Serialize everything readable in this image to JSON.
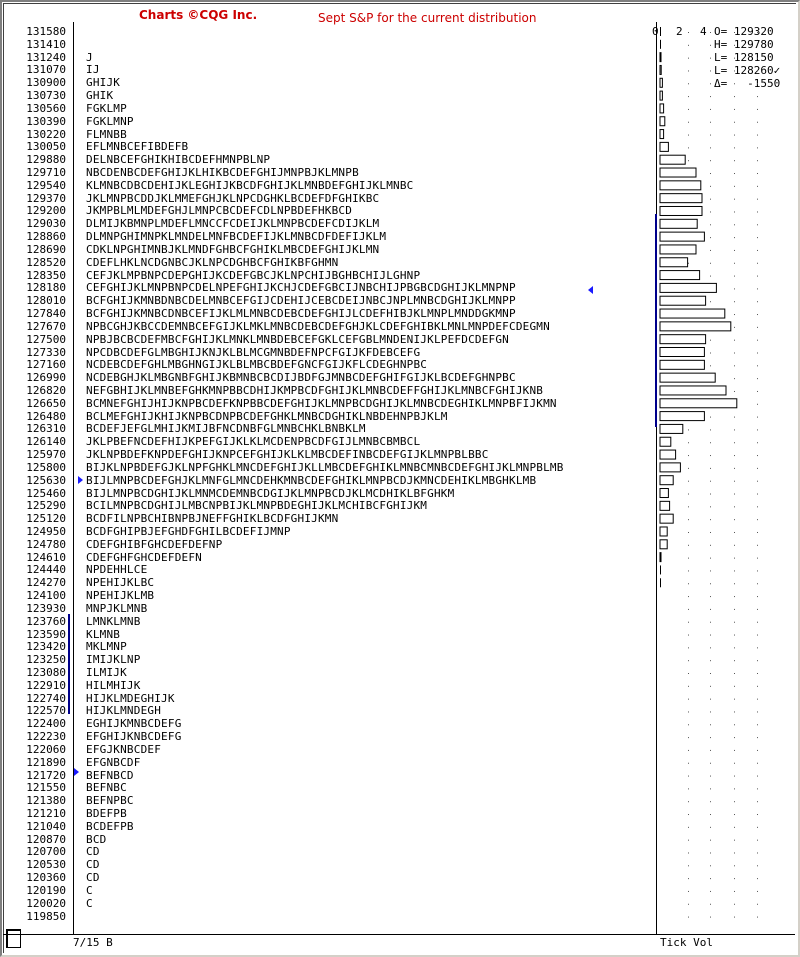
{
  "header": {
    "brand": "Charts ©CQG Inc.",
    "title": "Sept S&P for the current distribution"
  },
  "volume_scale": [
    "0",
    "2",
    "4"
  ],
  "stats": [
    "O= 129320",
    "H= 129780",
    "L= 128150",
    "L= 128260✓",
    "Δ=   -1550"
  ],
  "footer": {
    "date_label": "7/15 B",
    "panel_label": "Tick Vol"
  },
  "colors": {
    "title": "#cc0000",
    "value_area": "#00008b",
    "marker": "#1a1aff"
  },
  "chart_data": {
    "type": "table",
    "title": "Sept S&P for the current distribution",
    "rows": [
      {
        "price": "131580",
        "letters": "",
        "vol": 0
      },
      {
        "price": "131410",
        "letters": "",
        "vol": 0
      },
      {
        "price": "131240",
        "letters": "J",
        "vol": 0.05
      },
      {
        "price": "131070",
        "letters": "IJ",
        "vol": 0.1
      },
      {
        "price": "130900",
        "letters": "GHIJK",
        "vol": 0.2
      },
      {
        "price": "130730",
        "letters": "GHIK",
        "vol": 0.2
      },
      {
        "price": "130560",
        "letters": "FGKLMP",
        "vol": 0.3
      },
      {
        "price": "130390",
        "letters": "FGKLMNP",
        "vol": 0.4
      },
      {
        "price": "130220",
        "letters": "FLMNBB",
        "vol": 0.3
      },
      {
        "price": "130050",
        "letters": "EFLMNBCEFIBDEFB",
        "vol": 0.7
      },
      {
        "price": "129880",
        "letters": "DELNBCEFGHIKHIBCDEFHMNPBLNP",
        "vol": 2.1
      },
      {
        "price": "129710",
        "letters": "NBCDENBCDEFGHIJKLHIKBCDEFGHIJMNPBJKLMNPB",
        "vol": 3.0
      },
      {
        "price": "129540",
        "letters": "KLMNBCDBCDEHIJKLEGHIJKBCDFGHIJKLMNBDEFGHIJKLMNBC",
        "vol": 3.4
      },
      {
        "price": "129370",
        "letters": "JKLMNPBCDDJKLMMEFGHJKLNPCDGHKLBCDEFDFGHIKBC",
        "vol": 3.5
      },
      {
        "price": "129200",
        "letters": "JKMPBLMLMDEFGHJLMNPCBCDEFCDLNPBDEFHKBCD",
        "vol": 3.5
      },
      {
        "price": "129030",
        "letters": "DLMIJKBMNPLMDEFLMNCCFCDEIJKLMNPBCDEFCDIJKLM",
        "vol": 3.1
      },
      {
        "price": "128860",
        "letters": "DLMNPGHIMNPKLMNDELMNFBCDEFIJKLMNBCDFDEFIJKLM",
        "vol": 3.7
      },
      {
        "price": "128690",
        "letters": "CDKLNPGHIMNBJKLMNDFGHBCFGHIKLMBCDEFGHIJKLMN",
        "vol": 3.0
      },
      {
        "price": "128520",
        "letters": "CDEFLHKLNCDGNBCJKLNPCDGHBCFGHIKBFGHMN",
        "vol": 2.3
      },
      {
        "price": "128350",
        "letters": "CEFJKLMPBNPCDEPGHIJKCDEFGBCJKLNPCHIJBGHBCHIJLGHNP",
        "vol": 3.3
      },
      {
        "price": "128180",
        "letters": "CEFGHIJKLMNPBNPCDELNPEFGHIJKCHJCDEFGBCIJNBCHIJPBGBCDGHIJKLMNPNP",
        "vol": 4.7
      },
      {
        "price": "128010",
        "letters": "BCFGHIJKMNBDNBCDELMNBCEFGIJCDEHIJCEBCDEIJNBCJNPLMNBCDGHIJKLMNPP",
        "vol": 3.8
      },
      {
        "price": "127840",
        "letters": "BCFGHIJKMNBCDNBCEFIJKLMLMNBCDEBCDEFGHIJLCDEFHIBJKLMNPLMNDDGKMNP",
        "vol": 5.4
      },
      {
        "price": "127670",
        "letters": "NPBCGHJKBCCDEMNBCEFGIJKLMKLMNBCDEBCDEFGHJKLCDEFGHIBKLMNLMNPDEFCDEGMN",
        "vol": 5.9
      },
      {
        "price": "127500",
        "letters": "NPBJBCBCDEFMBCFGHIJKLMNKLMNBDEBCEFGKLCEFGBLMNDENIJKLPEFDCDEFGN",
        "vol": 3.8
      },
      {
        "price": "127330",
        "letters": "NPCDBCDEFGLMBGHIJKNJKLBLMCGMNBDEFNPCFGIJKFDEBCEFG",
        "vol": 3.7
      },
      {
        "price": "127160",
        "letters": "NCDEBCDEFGHLMBGHNGIJKLBLMBCBDEFGNCFGIJKFLCDEGHNPBC",
        "vol": 3.7
      },
      {
        "price": "126990",
        "letters": "NCDEBGHJKLMBGNBFGHIJKBMNBCBCDIJBDFGJMNBCDEFGHIFGIJKLBCDEFGHNPBC",
        "vol": 4.6
      },
      {
        "price": "126820",
        "letters": "NEFGBHIJKLMNBEFGHKMNPBBCDHIJKMPBCDFGHIJKLMNBCDEFFGHIJKLMNBCFGHIJKNB",
        "vol": 5.5
      },
      {
        "price": "126650",
        "letters": "BCMNEFGHIJHIJKNPBCDEFKNPBBCDEFGHIJKLMNPBCDGHIJKLMNBCDEGHIKLMNPBFIJKMN",
        "vol": 6.4
      },
      {
        "price": "126480",
        "letters": "BCLMEFGHIJKHIJKNPBCDNPBCDEFGHKLMNBCDGHIKLNBDEHNPBJKLM",
        "vol": 3.7
      },
      {
        "price": "126310",
        "letters": "BCDEFJEFGLMHIJKMIJBFNCDNBFGLMNBCHKLBNBKLM",
        "vol": 1.9
      },
      {
        "price": "126140",
        "letters": "JKLPBEFNCDEFHIJKPEFGIJKLKLMCDENPBCDFGIJLMNBCBMBCL",
        "vol": 0.9
      },
      {
        "price": "125970",
        "letters": "JKLNPBDEFKNPDEFGHIJKNPCEFGHIJKLKLMBCDEFINBCDEFGIJKLMNPBLBBC",
        "vol": 1.3
      },
      {
        "price": "125800",
        "letters": "BIJKLNPBDEFGJKLNPFGHKLMNCDEFGHIJKLLMBCDEFGHIKLMNBCMNBCDEFGHIJKLMNPBLMB",
        "vol": 1.7
      },
      {
        "price": "125630",
        "letters": "BIJLMNPBCDEFGHJKLMNFGLMNCDEHKMNBCDEFGHIKLMNPBCDJKMNCDEHIKLMBGHKLMB",
        "vol": 1.1
      },
      {
        "price": "125460",
        "letters": "BIJLMNPBCDGHIJKLMNMCDEMNBCDGIJKLMNPBCDJKLMCDHIKLBFGHKM",
        "vol": 0.7
      },
      {
        "price": "125290",
        "letters": "BCILMNPBCDGHIJLMBCNPBIJKLMNPBDEGHIJKLMCHIBCFGHIJKM",
        "vol": 0.8
      },
      {
        "price": "125120",
        "letters": "BCDFILNPBCHIBNPBJNEFFGHIKLBCDFGHIJKMN",
        "vol": 1.1
      },
      {
        "price": "124950",
        "letters": "BCDFGHIPBJEFGHDFGHILBCDEFIJMNP",
        "vol": 0.6
      },
      {
        "price": "124780",
        "letters": "CDEFGHIBFGHCDEFDEFNP",
        "vol": 0.6
      },
      {
        "price": "124610",
        "letters": "CDEFGHFGHCDEFDEFN",
        "vol": 0.05
      },
      {
        "price": "124440",
        "letters": "NPDEHHLCE",
        "vol": 0
      },
      {
        "price": "124270",
        "letters": "NPEHIJKLBC",
        "vol": 0
      },
      {
        "price": "124100",
        "letters": "NPEHIJKLMB",
        "vol": 0
      },
      {
        "price": "123930",
        "letters": "MNPJKLMNB",
        "vol": 0
      },
      {
        "price": "123760",
        "letters": "LMNKLMNB",
        "vol": 0
      },
      {
        "price": "123590",
        "letters": "KLMNB",
        "vol": 0
      },
      {
        "price": "123420",
        "letters": "MKLMNP",
        "vol": 0
      },
      {
        "price": "123250",
        "letters": "IMIJKLNP",
        "vol": 0
      },
      {
        "price": "123080",
        "letters": "ILMIJK",
        "vol": 0
      },
      {
        "price": "122910",
        "letters": "HILMHIJK",
        "vol": 0
      },
      {
        "price": "122740",
        "letters": "HIJKLMDEGHIJK",
        "vol": 0
      },
      {
        "price": "122570",
        "letters": "HIJKLMNDEGH",
        "vol": 0
      },
      {
        "price": "122400",
        "letters": "EGHIJKMNBCDEFG",
        "vol": 0
      },
      {
        "price": "122230",
        "letters": "EFGHIJKNBCDEFG",
        "vol": 0
      },
      {
        "price": "122060",
        "letters": "EFGJKNBCDEF",
        "vol": 0
      },
      {
        "price": "121890",
        "letters": "EFGNBCDF",
        "vol": 0
      },
      {
        "price": "121720",
        "letters": "BEFNBCD",
        "vol": 0
      },
      {
        "price": "121550",
        "letters": "BEFNBC",
        "vol": 0
      },
      {
        "price": "121380",
        "letters": "BEFNPBC",
        "vol": 0
      },
      {
        "price": "121210",
        "letters": "BDEFPB",
        "vol": 0
      },
      {
        "price": "121040",
        "letters": "BCDEFPB",
        "vol": 0
      },
      {
        "price": "120870",
        "letters": "BCD",
        "vol": 0
      },
      {
        "price": "120700",
        "letters": "CD",
        "vol": 0
      },
      {
        "price": "120530",
        "letters": "CD",
        "vol": 0
      },
      {
        "price": "120360",
        "letters": "CD",
        "vol": 0
      },
      {
        "price": "120190",
        "letters": "C",
        "vol": 0
      },
      {
        "price": "120020",
        "letters": "C",
        "vol": 0
      },
      {
        "price": "119850",
        "letters": "",
        "vol": 0
      }
    ],
    "vol_range": [
      0,
      4
    ],
    "value_area_top": "129030",
    "value_area_bottom": "126480",
    "lower_range_top": "123930",
    "lower_range_bottom": "122740"
  }
}
